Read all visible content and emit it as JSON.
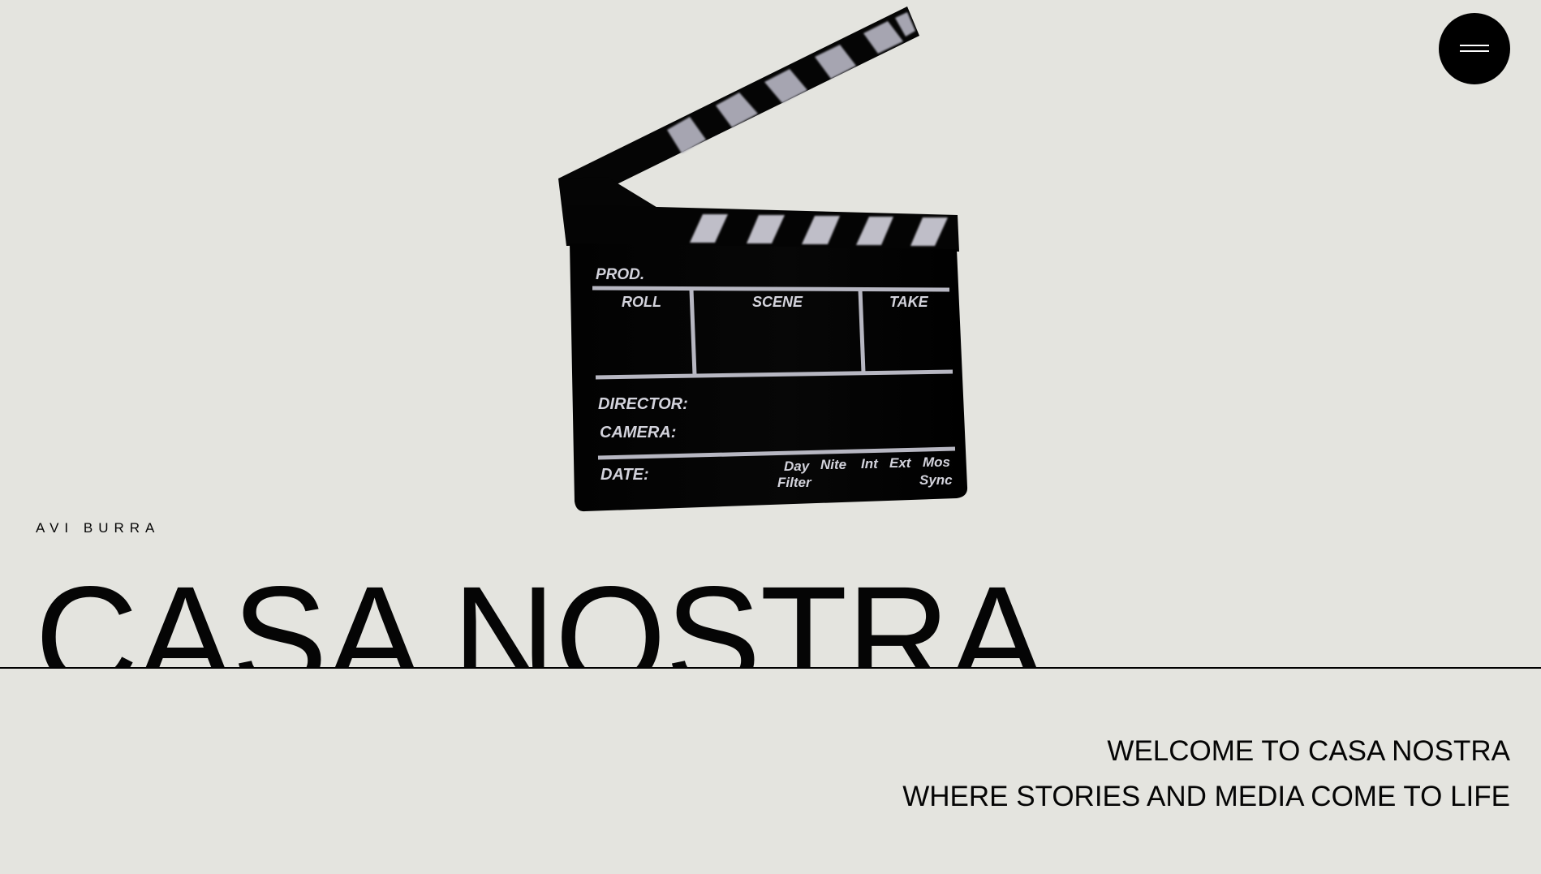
{
  "header": {
    "menu_icon": "hamburger-menu-icon"
  },
  "hero": {
    "author": "AVI BURRA",
    "title": "CASA NOSTRA"
  },
  "clapperboard": {
    "icon": "clapperboard-icon",
    "labels": {
      "prod": "PROD.",
      "roll": "ROLL",
      "scene": "SCENE",
      "take": "TAKE",
      "director": "DIRECTOR:",
      "camera": "CAMERA:",
      "date": "DATE:",
      "day": "Day",
      "nite": "Nite",
      "int": "Int",
      "ext": "Ext",
      "mos": "Mos",
      "filter": "Filter",
      "sync": "Sync"
    }
  },
  "intro": {
    "line1": "WELCOME TO CASA NOSTRA",
    "line2": "WHERE STORIES AND MEDIA COME TO LIFE"
  },
  "colors": {
    "background": "#e4e4df",
    "text": "#050505",
    "button": "#000000"
  }
}
